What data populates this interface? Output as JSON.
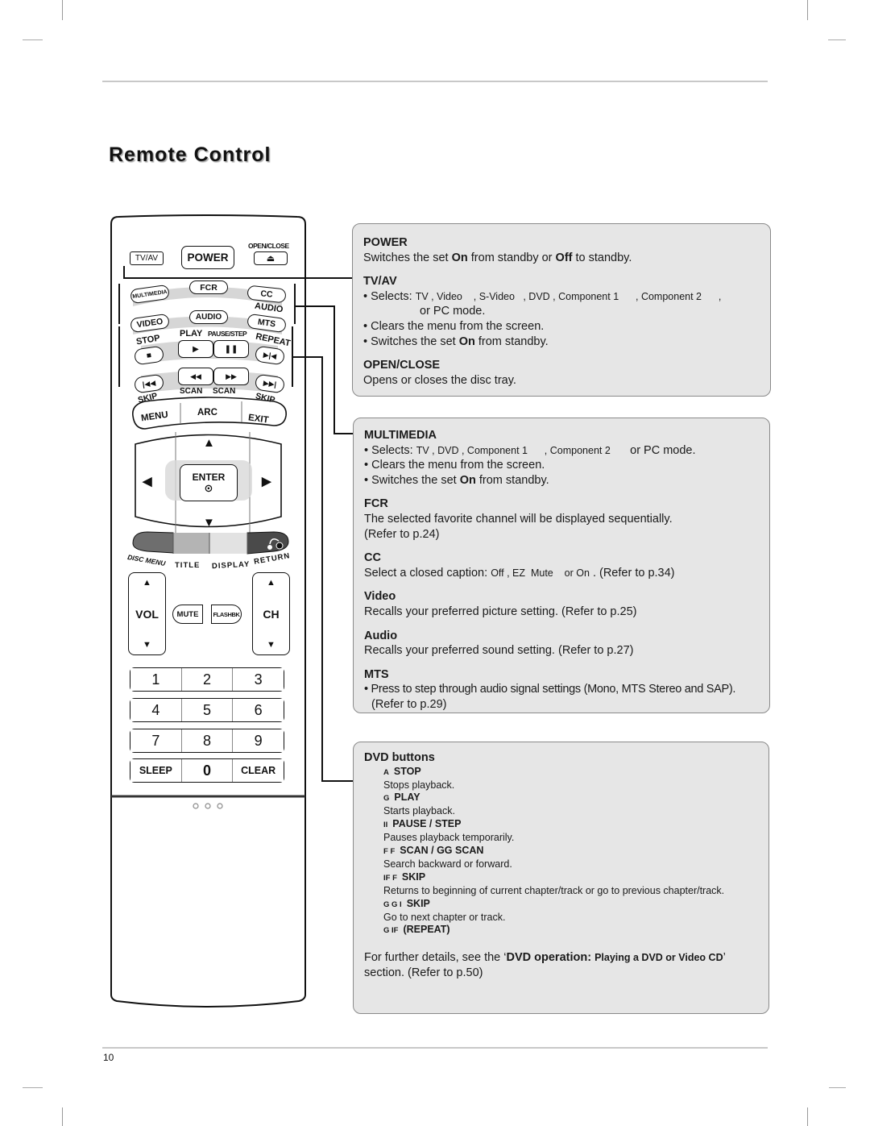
{
  "page": {
    "title": "Remote Control",
    "page_number": "10"
  },
  "remote": {
    "buttons": {
      "tv_av": "TV/AV",
      "power": "POWER",
      "open_close": "OPEN/CLOSE",
      "multimedia": "MULTIMEDIA",
      "fcr": "FCR",
      "cc": "CC",
      "audio_top": "AUDIO",
      "video": "VIDEO",
      "audio": "AUDIO",
      "mts": "MTS",
      "stop": "STOP",
      "play": "PLAY",
      "pause_step": "PAUSE/STEP",
      "repeat": "REPEAT",
      "skip_back": "SKIP",
      "scan_back": "SCAN",
      "scan_fwd": "SCAN",
      "skip_fwd": "SKIP",
      "menu": "MENU",
      "arc": "ARC",
      "exit": "EXIT",
      "enter": "ENTER",
      "disc_menu": "DISC MENU",
      "title": "TITLE",
      "display": "DISPLAY",
      "return": "RETURN",
      "vol": "VOL",
      "mute": "MUTE",
      "flashbk": "FLASHBK",
      "ch": "CH",
      "sleep": "SLEEP",
      "clear": "CLEAR"
    },
    "number_keys": [
      "1",
      "2",
      "3",
      "4",
      "5",
      "6",
      "7",
      "8",
      "9",
      "0"
    ],
    "colors": {
      "disc_menu": "#6e6e6e",
      "title": "#b4b4b4",
      "display": "#e2e2e2",
      "return": "#4a4a4a",
      "arc_band": "#d6d6d6"
    }
  },
  "callouts": {
    "box1": {
      "power_heading": "POWER",
      "power_text_pre": "Switches the set ",
      "power_on": "On",
      "power_text_mid": " from standby or ",
      "power_off": "Off",
      "power_text_post": " to standby.",
      "tvav_heading": "TV/AV",
      "tvav_selects_label": "• Selects: ",
      "tvav_modes": "TV , Video    , S-Video   , DVD , Component 1      , Component 2      ,",
      "tvav_modes_line2": "or PC  mode.",
      "tvav_clears": "• Clears the menu from the screen.",
      "tvav_switch_pre": "• Switches the set ",
      "tvav_switch_on": "On",
      "tvav_switch_post": " from standby.",
      "openclose_heading": "OPEN/CLOSE",
      "openclose_text": "Opens or closes the disc tray."
    },
    "box2": {
      "multimedia_heading": "MULTIMEDIA",
      "mm_selects_label": "• Selects: ",
      "mm_modes": "TV , DVD , Component 1      , Component 2       ",
      "mm_modes_tail": "or PC  mode.",
      "mm_clears": "• Clears the menu from the screen.",
      "mm_switch_pre": "• Switches the set ",
      "mm_switch_on": "On",
      "mm_switch_post": " from standby.",
      "fcr_heading": "FCR",
      "fcr_text": "The selected favorite channel will be displayed sequentially.",
      "fcr_ref": "(Refer to p.24)",
      "cc_heading": "CC",
      "cc_text_pre": "Select a closed caption: ",
      "cc_options": "Off , EZ  Mute    or On",
      "cc_text_post": " . (Refer to p.34)",
      "video_heading": "Video",
      "video_text": "Recalls your preferred picture setting. (Refer to p.25)",
      "audio_heading": "Audio",
      "audio_text": "Recalls your preferred sound setting. (Refer to p.27)",
      "mts_heading": "MTS",
      "mts_text": "• Press to step through audio signal settings (Mono, MTS Stereo and SAP).",
      "mts_ref": "(Refer to p.29)"
    },
    "box3": {
      "heading": "DVD buttons",
      "items": [
        {
          "symbol": "A",
          "label": "STOP",
          "desc": "Stops playback."
        },
        {
          "symbol": "G",
          "label": "PLAY",
          "desc": "Starts playback."
        },
        {
          "symbol": "II",
          "label": "PAUSE / STEP",
          "desc": "Pauses playback temporarily."
        },
        {
          "symbol": "F F",
          "label": "SCAN / GG  SCAN",
          "desc": "Search backward or forward."
        },
        {
          "symbol": "IF F",
          "label": "SKIP",
          "desc": "Returns to beginning of current chapter/track or go to previous chapter/track."
        },
        {
          "symbol": "G G I",
          "label": "SKIP",
          "desc": "Go to next chapter or track."
        },
        {
          "symbol": "G IF",
          "label": "(REPEAT)",
          "desc": ""
        }
      ],
      "footer_pre": "For further details, see the ‘",
      "footer_bold": "DVD operation: ",
      "footer_bold_small": "Playing a DVD or Video CD",
      "footer_post": "’",
      "footer_line2": "section. (Refer to p.50)"
    }
  }
}
